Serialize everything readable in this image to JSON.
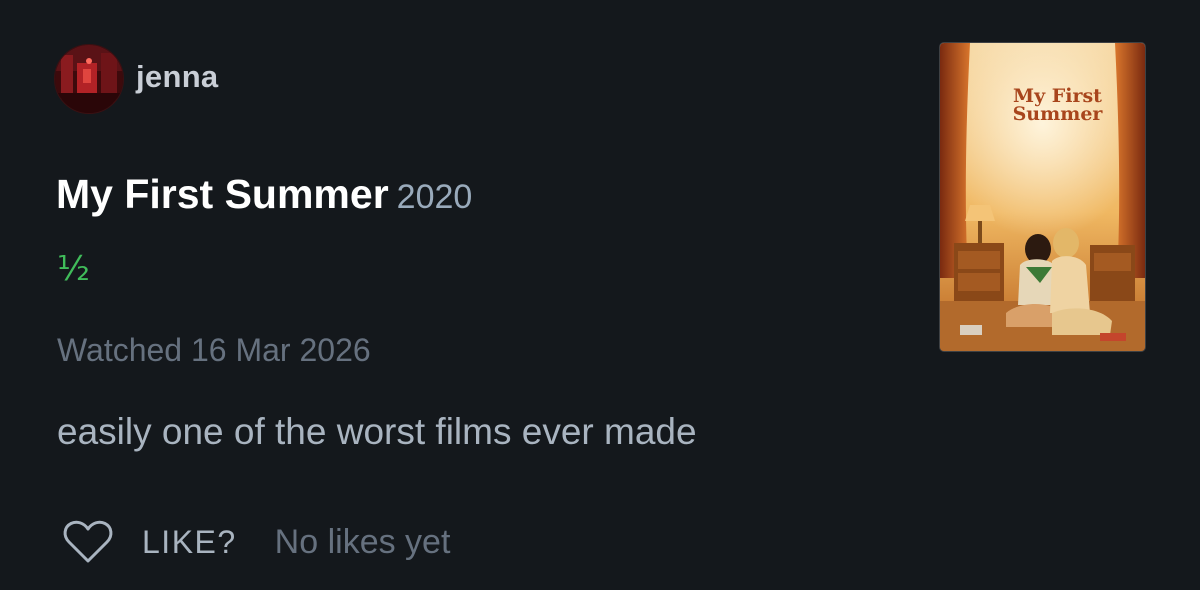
{
  "author": {
    "username": "jenna"
  },
  "film": {
    "title": "My First Summer",
    "year": "2020",
    "rating": "½",
    "poster_title": "My First\nSummer"
  },
  "entry": {
    "watched": "Watched 16 Mar 2026",
    "review": "easily one of the worst films ever made"
  },
  "likes": {
    "like_label": "LIKE?",
    "count_text": "No likes yet",
    "icon": "heart-icon"
  },
  "colors": {
    "background": "#14181c",
    "rating_green": "#40bc5a",
    "muted": "#66717f",
    "body_text": "#a9b4c0"
  }
}
